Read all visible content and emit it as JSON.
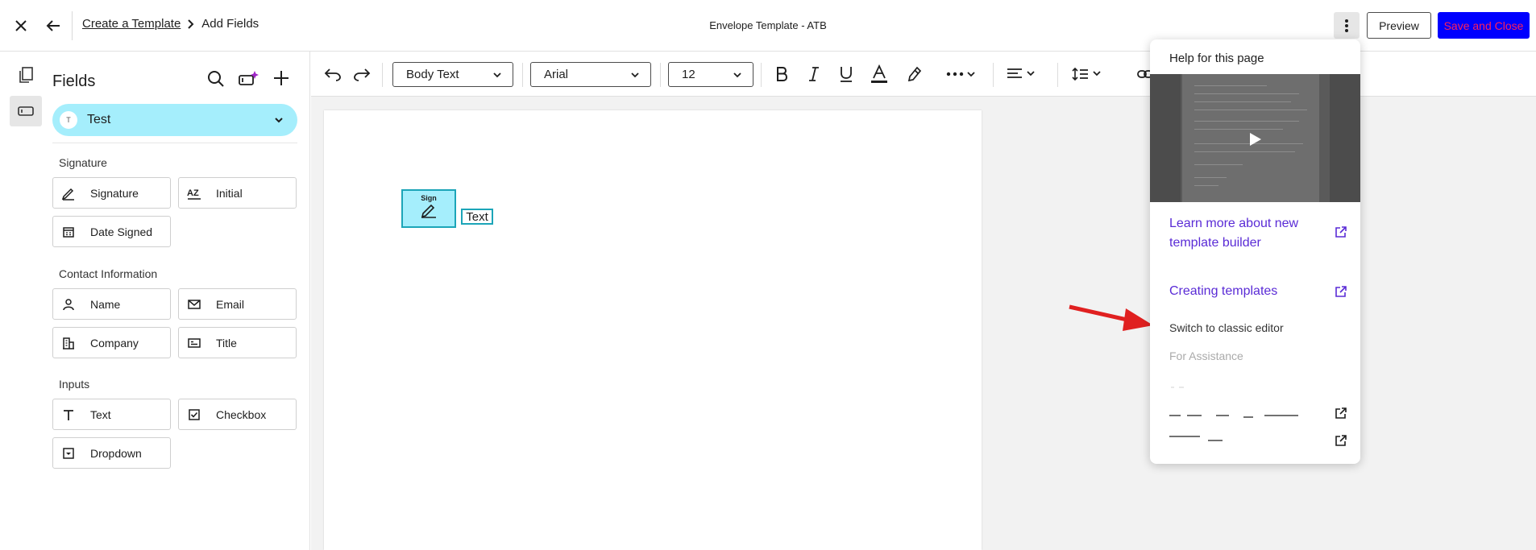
{
  "header": {
    "breadcrumb_link": "Create a Template",
    "breadcrumb_current": "Add Fields",
    "envelope_title": "Envelope Template - ATB",
    "preview_label": "Preview",
    "save_label": "Save and Close"
  },
  "panel": {
    "title": "Fields",
    "recipient_initial": "T",
    "recipient_name": "Test",
    "sections": {
      "signature": "Signature",
      "contact": "Contact Information",
      "inputs": "Inputs"
    },
    "fields": {
      "signature": "Signature",
      "initial": "Initial",
      "date_signed": "Date Signed",
      "name": "Name",
      "email": "Email",
      "company": "Company",
      "title": "Title",
      "text": "Text",
      "checkbox": "Checkbox",
      "dropdown": "Dropdown"
    }
  },
  "toolbar": {
    "style": "Body Text",
    "font": "Arial",
    "size": "12"
  },
  "document": {
    "sign_label": "Sign",
    "text_field_label": "Text"
  },
  "help": {
    "title": "Help for this page",
    "link_learn": "Learn more about new template builder",
    "link_creating": "Creating templates",
    "switch_classic": "Switch to classic editor",
    "for_assistance": "For Assistance"
  },
  "colors": {
    "accent_link": "#5a2bd6",
    "save_bg": "#0000ff",
    "save_text": "#ff1f5a",
    "field_fill": "#a5eefc",
    "annotation_arrow": "#e02020"
  }
}
